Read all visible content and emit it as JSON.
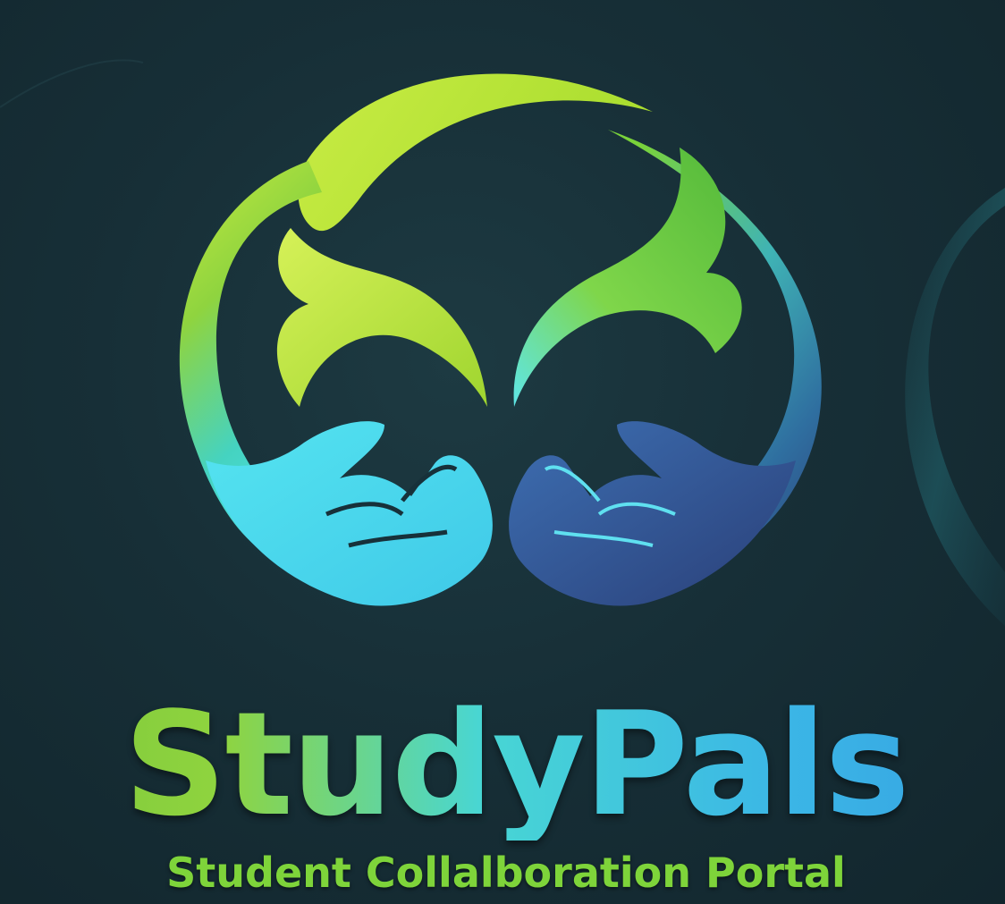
{
  "brand": {
    "name": "StudyPals",
    "tagline": "Student Collalboration Portal"
  },
  "logo": {
    "icon": "two-hands-holding-leaves-icon"
  },
  "colors": {
    "background": "#172f37",
    "lime": "#b7e83c",
    "green": "#6cc531",
    "cyan": "#4fe3ee",
    "blue": "#3bb6e6",
    "navy": "#2f4e86",
    "tagline": "#7ed43a"
  }
}
